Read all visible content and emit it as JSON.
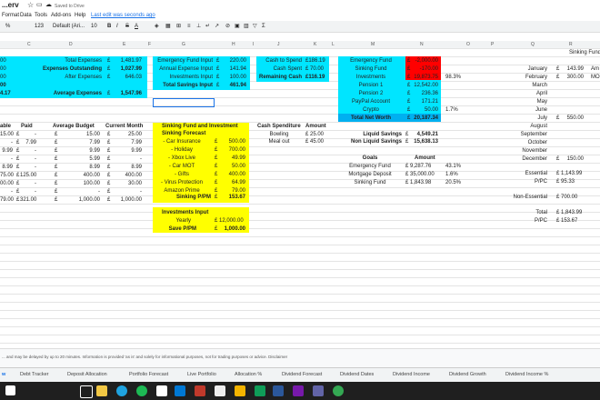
{
  "app": {
    "title": "...erv",
    "saved": "Saved to Drive"
  },
  "menu": [
    "Format",
    "Data",
    "Tools",
    "Add-ons",
    "Help"
  ],
  "last_edit": "Last edit was seconds ago",
  "toolbar": {
    "zoom": "100",
    "font": "Default (Ari...",
    "size": "10",
    "pct": "%",
    ".0": ".0",
    ".00": ".00",
    "fmt": "123"
  },
  "columns": [
    "C",
    "D",
    "E",
    "F",
    "G",
    "H",
    "I",
    "J",
    "K",
    "L",
    "M",
    "N",
    "O",
    "P",
    "Q",
    "R"
  ],
  "summary": {
    "total_expenses_label": "Total Expenses",
    "total_expenses_cur": "£",
    "total_expenses": "1,481.97",
    "outstanding_label": "Expenses Outstanding",
    "outstanding_cur": "£",
    "outstanding": "1,027.99",
    "after_label": "After Expenses",
    "after_cur": "£",
    "after": "646.03",
    "avg_label": "Average Expenses",
    "avg_cur": "£",
    "avg": "1,547.96",
    "left_vals": [
      "00",
      "00",
      "00",
      "00",
      "4.17"
    ]
  },
  "income": {
    "rows": [
      {
        "label": "Emergency Fund Input",
        "cur": "£",
        "val": "220.00"
      },
      {
        "label": "Annual Expense Input",
        "cur": "£",
        "val": "141.94"
      },
      {
        "label": "Investments Input",
        "cur": "£",
        "val": "100.00"
      },
      {
        "label": "Total Savings Input",
        "cur": "£",
        "val": "461.94"
      }
    ]
  },
  "cash": {
    "spend_label": "Cash to Spend",
    "spend": "£186.19",
    "spent_label": "Cash Spent",
    "spent": "£ 70.00",
    "remaining_label": "Remaining Cash",
    "remaining": "£116.19"
  },
  "networth": {
    "rows": [
      {
        "label": "Emergency Fund",
        "cur": "£",
        "val": "-2,000.00",
        "pct": ""
      },
      {
        "label": "Sinking Fund",
        "cur": "£",
        "val": "-170.00",
        "pct": ""
      },
      {
        "label": "Investments",
        "cur": "£",
        "val": "19,873.75",
        "pct": "98.3%"
      },
      {
        "label": "Pension 1",
        "cur": "£",
        "val": "12,542.00",
        "pct": ""
      },
      {
        "label": "Pension 2",
        "cur": "£",
        "val": "236.36",
        "pct": ""
      },
      {
        "label": "PayPal Account",
        "cur": "£",
        "val": "171.21",
        "pct": ""
      },
      {
        "label": "Crypto",
        "cur": "£",
        "val": "50.00",
        "pct": "1.7%"
      },
      {
        "label": "Total Net Worth",
        "cur": "£",
        "val": "20,187.34",
        "pct": ""
      }
    ]
  },
  "budget_table": {
    "headers": [
      "able",
      "Paid",
      "Average Budget",
      "Current Month"
    ],
    "rows": [
      {
        "a": "15.00",
        "p_cur": "£",
        "p": "-",
        "avg_cur": "£",
        "avg": "15.00",
        "cur_cur": "£",
        "cur": "25.00"
      },
      {
        "a": "-",
        "p_cur": "£",
        "p": "7.99",
        "avg_cur": "£",
        "avg": "7.99",
        "cur_cur": "£",
        "cur": "7.99"
      },
      {
        "a": "9.99",
        "p_cur": "£",
        "p": "-",
        "avg_cur": "£",
        "avg": "9.99",
        "cur_cur": "£",
        "cur": "9.99"
      },
      {
        "a": "-",
        "p_cur": "£",
        "p": "-",
        "avg_cur": "£",
        "avg": "5.99",
        "cur_cur": "£",
        "cur": "-"
      },
      {
        "a": "8.99",
        "p_cur": "£",
        "p": "-",
        "avg_cur": "£",
        "avg": "8.99",
        "cur_cur": "£",
        "cur": "8.99"
      },
      {
        "a": "75.00",
        "p_cur": "£",
        "p": "125.00",
        "avg_cur": "£",
        "avg": "400.00",
        "cur_cur": "£",
        "cur": "400.00"
      },
      {
        "a": "00.00",
        "p_cur": "£",
        "p": "-",
        "avg_cur": "£",
        "avg": "100.00",
        "cur_cur": "£",
        "cur": "30.00"
      },
      {
        "a": "-",
        "p_cur": "£",
        "p": "-",
        "avg_cur": "£",
        "avg": "-",
        "cur_cur": "£",
        "cur": "-"
      },
      {
        "a": "79.00",
        "p_cur": "£",
        "p": "321.00",
        "avg_cur": "£",
        "avg": "1,000.00",
        "cur_cur": "£",
        "cur": "1,000.00"
      }
    ]
  },
  "sinking": {
    "title1": "Sinking Fund and Investment",
    "title2": "Sinking Forecast",
    "rows": [
      {
        "label": "- Car Insurance",
        "cur": "£",
        "val": "500.00"
      },
      {
        "label": "- Holiday",
        "cur": "£",
        "val": "700.00"
      },
      {
        "label": "- Xbox Live",
        "cur": "£",
        "val": "49.99"
      },
      {
        "label": "- Car MOT",
        "cur": "£",
        "val": "50.00"
      },
      {
        "label": "- Gifts",
        "cur": "£",
        "val": "400.00"
      },
      {
        "label": "- Virus Protection",
        "cur": "£",
        "val": "64.99"
      },
      {
        "label": "Amazon Prime",
        "cur": "£",
        "val": "79.00"
      }
    ],
    "ppm_label": "Sinking P/PM",
    "ppm_cur": "£",
    "ppm": "153.67",
    "inv_title": "Investments Input",
    "yearly_label": "Yearly",
    "yearly": "£ 12,000.00",
    "save_label": "Save P/PM",
    "save_cur": "£",
    "save": "1,000.00"
  },
  "cash_spend": {
    "h1": "Cash Spenditure",
    "h2": "Amount",
    "rows": [
      {
        "label": "Bowling",
        "val": "£ 25.00"
      },
      {
        "label": "Meal out",
        "val": "£ 45.00"
      }
    ]
  },
  "savings": {
    "liquid_label": "Liquid Savings",
    "liquid_cur": "£",
    "liquid": "4,549.21",
    "nonliquid_label": "Non Liquid Savings",
    "nonliquid_cur": "£",
    "nonliquid": "15,638.13"
  },
  "goals": {
    "h1": "Goals",
    "h2": "Amount",
    "rows": [
      {
        "label": "Emergency Fund",
        "val": "£ 9,287.76",
        "pct": "43.1%"
      },
      {
        "label": "Mortgage Deposit",
        "val": "£ 35,000.00",
        "pct": "1.6%"
      },
      {
        "label": "Sinking Fund",
        "val": "£ 1,843.98",
        "pct": "20.5%"
      }
    ]
  },
  "months": {
    "header": "Sinking Fund",
    "rows": [
      {
        "m": "January",
        "cur": "£",
        "v": "143.99",
        "x": "Am"
      },
      {
        "m": "February",
        "cur": "£",
        "v": "300.00",
        "x": "MO"
      },
      {
        "m": "March",
        "cur": "",
        "v": "",
        "x": ""
      },
      {
        "m": "April",
        "cur": "",
        "v": "",
        "x": ""
      },
      {
        "m": "May",
        "cur": "",
        "v": "",
        "x": ""
      },
      {
        "m": "June",
        "cur": "",
        "v": "",
        "x": ""
      },
      {
        "m": "July",
        "cur": "£",
        "v": "550.00",
        "x": ""
      },
      {
        "m": "August",
        "cur": "",
        "v": "",
        "x": ""
      },
      {
        "m": "September",
        "cur": "",
        "v": "",
        "x": ""
      },
      {
        "m": "October",
        "cur": "",
        "v": "",
        "x": ""
      },
      {
        "m": "November",
        "cur": "",
        "v": "",
        "x": ""
      },
      {
        "m": "December",
        "cur": "£",
        "v": "150.00",
        "x": ""
      }
    ],
    "essential_label": "Essential",
    "essential": "£ 1,143.99",
    "ppc1_label": "P/PC",
    "ppc1": "£ 95.33",
    "nonessential_label": "Non-Essential",
    "nonessential": "£ 700.00",
    "total_label": "Total",
    "total": "£ 1,843.99",
    "ppc2_label": "P/PC",
    "ppc2": "£ 153.67"
  },
  "info_text": "... and may be delayed by up to 20 minutes. Information is provided 'as is' and solely for informational purposes, not for trading purposes or advice. Disclaimer",
  "tabs": [
    "w",
    "Debt Tracker",
    "Deposit Allocation",
    "Portfolio Forecast",
    "Live Portfolio",
    "Allocation %",
    "Dividend Forecast",
    "Dividend Dates",
    "Dividend Income",
    "Dividend Growth",
    "Dividend Income %"
  ]
}
